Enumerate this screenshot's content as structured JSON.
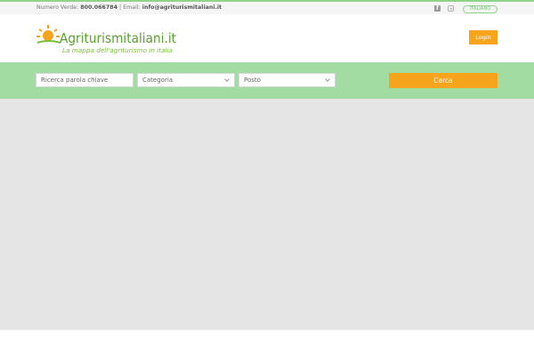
{
  "topbar": {
    "phone_label": "Numero Verde:",
    "phone": "800.066784",
    "separator": "|",
    "email_label": "Email:",
    "email": "info@agriturismitaliani.it",
    "social_icons": [
      "facebook-icon",
      "instagram-icon"
    ],
    "language": "ITALIANO"
  },
  "header": {
    "logo_text": "Agriturismitaliani.it",
    "logo_tagline": "La mappa dell'agriturismo in italia",
    "login_label": "Login"
  },
  "search": {
    "keyword_placeholder": "Ricerca parola chiave",
    "category_label": "Categoria",
    "place_label": "Posto",
    "submit_label": "Cerca"
  },
  "colors": {
    "accent_green": "#a3dca3",
    "accent_orange": "#f5a41c",
    "logo_green": "#5aa031",
    "map_background": "#e5e5e5"
  }
}
